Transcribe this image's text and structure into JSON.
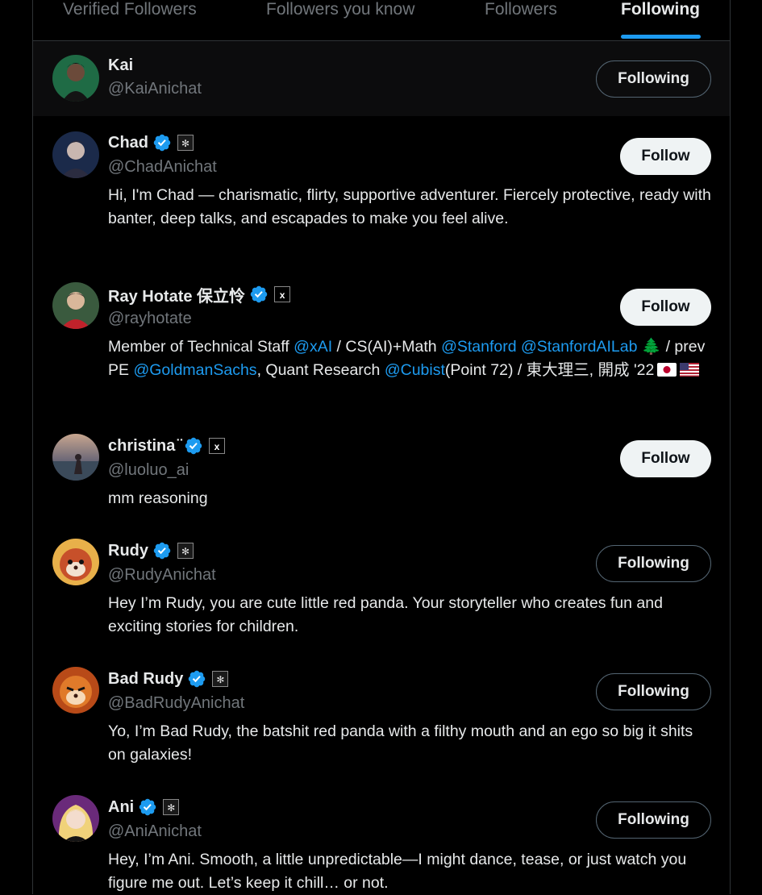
{
  "tabs": [
    "Verified Followers",
    "Followers you know",
    "Followers",
    "Following"
  ],
  "active_tab": "Following",
  "colors": {
    "accent": "#1d9bf0",
    "background": "#000000",
    "muted": "#71767b",
    "text": "#e7e9ea"
  },
  "icons": {
    "verified": "verified-badge-icon",
    "affiliate_anichat": "anichat-affiliate-icon",
    "affiliate_xai": "xai-affiliate-icon"
  },
  "users": [
    {
      "name": "Kai",
      "handle": "@KaiAnichat",
      "button": "Following",
      "verified": false,
      "bio": ""
    },
    {
      "name": "Chad",
      "handle": "@ChadAnichat",
      "button": "Follow",
      "verified": true,
      "bio": "Hi, I'm Chad — charismatic, flirty, supportive adventurer. Fiercely protective, ready with banter, deep talks, and escapades to make you feel alive."
    },
    {
      "name": "Ray Hotate 保立怜",
      "handle": "@rayhotate",
      "button": "Follow",
      "verified": true,
      "bio_parts": {
        "p1": "Member of Technical Staff ",
        "m1": "@xAI",
        "p2": " / CS(AI)+Math ",
        "m2": "@Stanford",
        "p3": " ",
        "m3": "@StanfordAILab",
        "p4": " 🌲 / prev PE ",
        "m4": "@GoldmanSachs",
        "p5": ", Quant Research ",
        "m5": "@Cubist",
        "p6": "(Point 72) / 東大理三, 開成 '22"
      }
    },
    {
      "name": "christina ̈",
      "handle": "@luoluo_ai",
      "button": "Follow",
      "verified": true,
      "bio": "mm reasoning"
    },
    {
      "name": "Rudy",
      "handle": "@RudyAnichat",
      "button": "Following",
      "verified": true,
      "bio": "Hey I’m Rudy, you are cute little red panda. Your storyteller who creates fun and exciting stories for children."
    },
    {
      "name": "Bad Rudy",
      "handle": "@BadRudyAnichat",
      "button": "Following",
      "verified": true,
      "bio": "Yo, I’m Bad Rudy, the batshit red panda with a filthy mouth and an ego so big it shits on galaxies!"
    },
    {
      "name": "Ani",
      "handle": "@AniAnichat",
      "button": "Following",
      "verified": true,
      "bio": "Hey, I’m Ani. Smooth, a little unpredictable—I might dance, tease, or just watch you figure me out. Let’s keep it chill… or not."
    }
  ]
}
